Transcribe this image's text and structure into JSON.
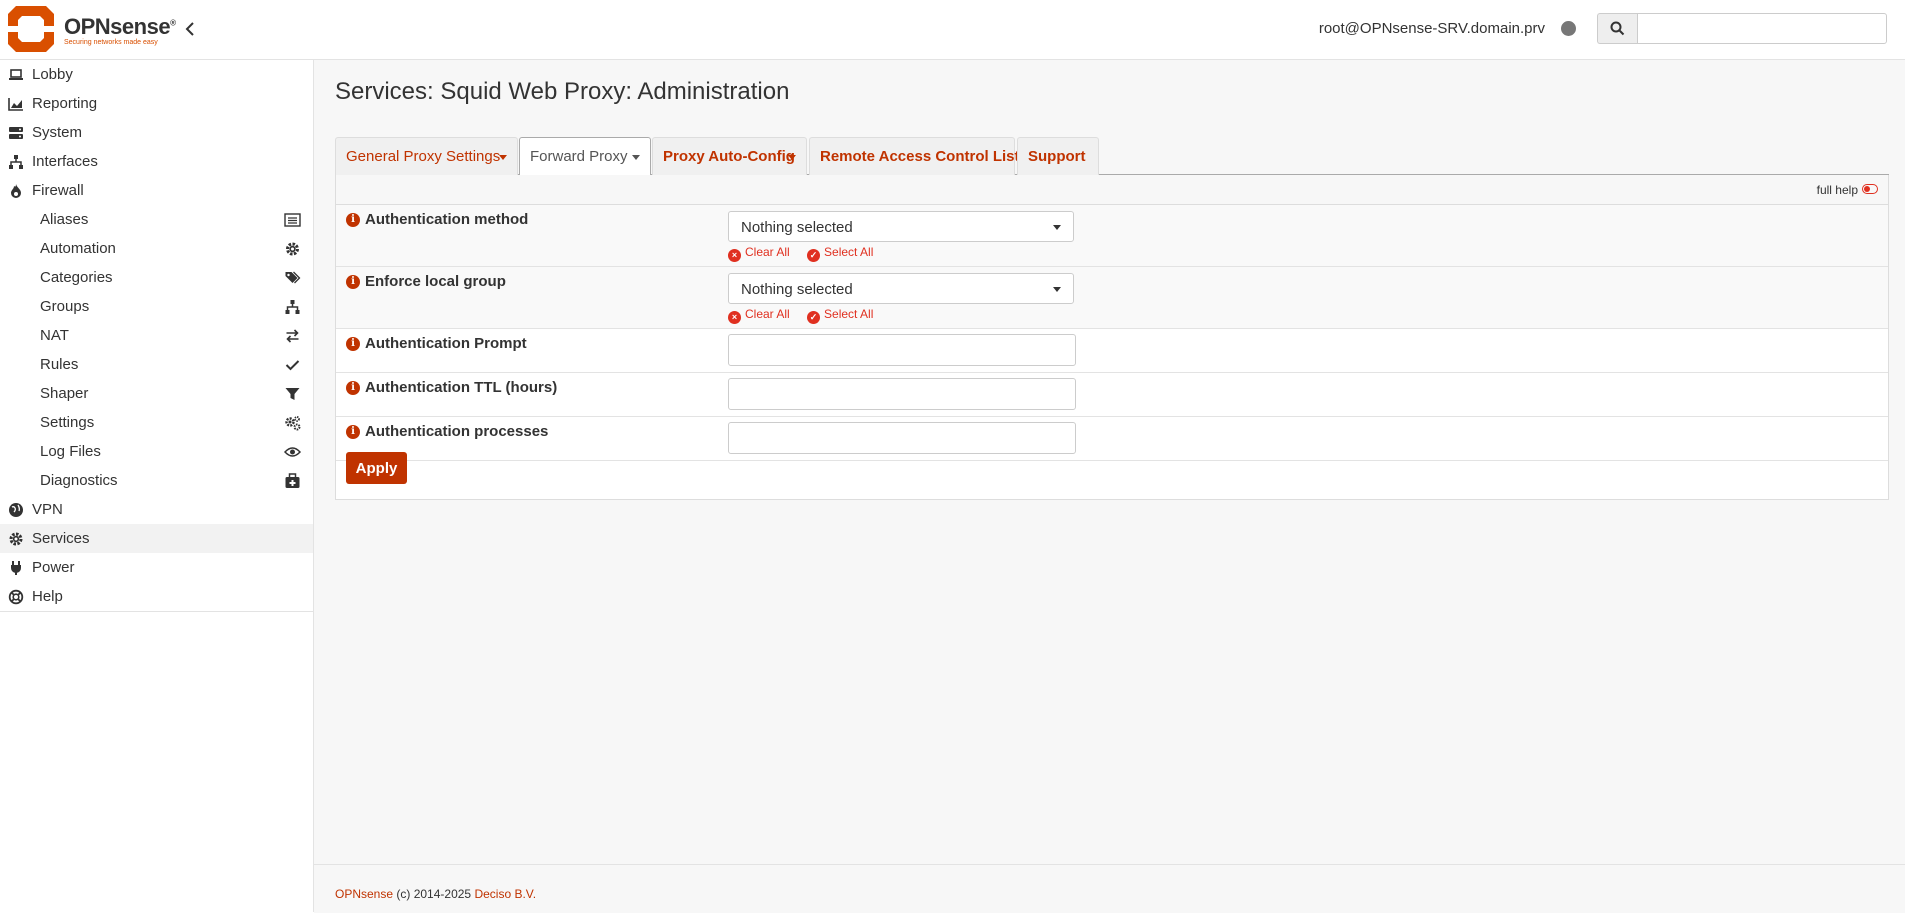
{
  "header": {
    "brand_name": "OPNsense",
    "brand_reg": "®",
    "tagline": "Securing networks made easy",
    "user": "root@OPNsense-SRV.domain.prv",
    "search_placeholder": ""
  },
  "sidebar": {
    "items": [
      {
        "label": "Lobby",
        "icon": "laptop-icon"
      },
      {
        "label": "Reporting",
        "icon": "area-chart-icon"
      },
      {
        "label": "System",
        "icon": "server-icon"
      },
      {
        "label": "Interfaces",
        "icon": "sitemap-icon"
      },
      {
        "label": "Firewall",
        "icon": "fire-icon"
      }
    ],
    "firewall_sub": [
      {
        "label": "Aliases",
        "icon": "list-icon"
      },
      {
        "label": "Automation",
        "icon": "gear-icon"
      },
      {
        "label": "Categories",
        "icon": "tags-icon"
      },
      {
        "label": "Groups",
        "icon": "sitemap-icon"
      },
      {
        "label": "NAT",
        "icon": "exchange-icon"
      },
      {
        "label": "Rules",
        "icon": "check-icon"
      },
      {
        "label": "Shaper",
        "icon": "filter-icon"
      },
      {
        "label": "Settings",
        "icon": "gears-icon"
      },
      {
        "label": "Log Files",
        "icon": "eye-icon"
      },
      {
        "label": "Diagnostics",
        "icon": "medkit-icon"
      }
    ],
    "items_after": [
      {
        "label": "VPN",
        "icon": "globe-icon"
      },
      {
        "label": "Services",
        "icon": "gear-icon"
      },
      {
        "label": "Power",
        "icon": "plug-icon"
      },
      {
        "label": "Help",
        "icon": "life-ring-icon"
      }
    ]
  },
  "main": {
    "title": "Services: Squid Web Proxy: Administration",
    "tabs": [
      {
        "label": "General Proxy Settings"
      },
      {
        "label": "Forward Proxy"
      },
      {
        "label": "Proxy Auto-Config"
      },
      {
        "label": "Remote Access Control Lists"
      },
      {
        "label": "Support"
      }
    ],
    "full_help": "full help",
    "fields": {
      "auth_method": {
        "label": "Authentication method",
        "value": "Nothing selected"
      },
      "local_group": {
        "label": "Enforce local group",
        "value": "Nothing selected"
      },
      "auth_prompt": {
        "label": "Authentication Prompt",
        "value": ""
      },
      "auth_ttl": {
        "label": "Authentication TTL (hours)",
        "value": ""
      },
      "auth_processes": {
        "label": "Authentication processes",
        "value": ""
      }
    },
    "clear_all": "Clear All",
    "select_all": "Select All",
    "apply": "Apply"
  },
  "footer": {
    "brand": "OPNsense",
    "copyright": "(c) 2014-2025",
    "company": "Deciso B.V."
  },
  "colors": {
    "accent": "#c03300",
    "link_red": "#e03020"
  }
}
